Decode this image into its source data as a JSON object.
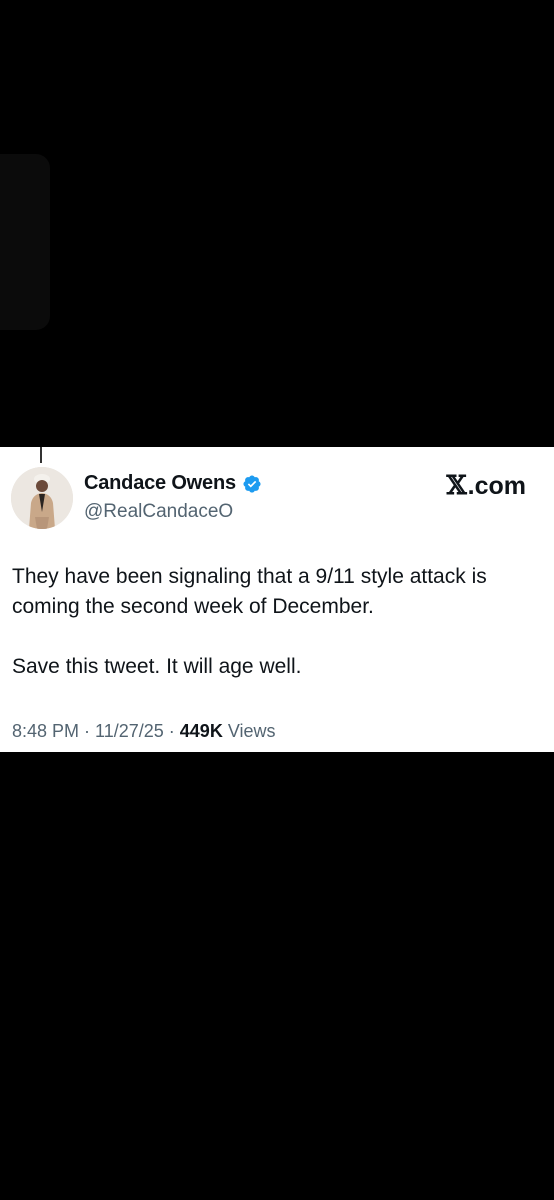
{
  "tweet": {
    "author": {
      "name": "Candace Owens",
      "handle": "@RealCandaceO",
      "verified": true,
      "verified_color": "#1d9bf0"
    },
    "brand": {
      "x_glyph": "𝕏",
      "suffix": ".com"
    },
    "body": {
      "paragraph_1": "They have been signaling that a 9/11 style attack is coming the second week of December.",
      "paragraph_2": "Save this tweet. It will age well."
    },
    "meta": {
      "time": "8:48 PM",
      "separator_1": " · ",
      "date": "11/27/25",
      "separator_2": " · ",
      "views_count": "449K",
      "views_label": " Views"
    }
  },
  "colors": {
    "background": "#000000",
    "card": "#ffffff",
    "text_primary": "#0f1419",
    "text_secondary": "#536471"
  }
}
